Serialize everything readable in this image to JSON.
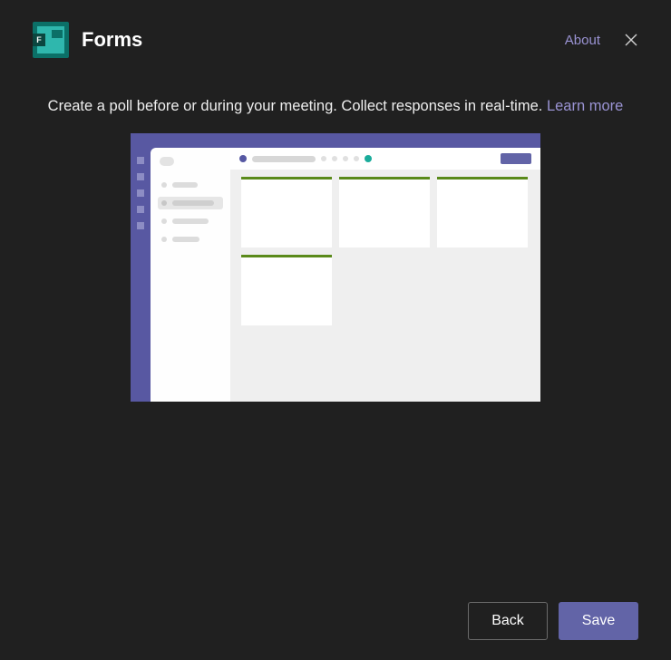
{
  "header": {
    "title": "Forms",
    "icon_letter": "F",
    "about_label": "About"
  },
  "description": {
    "text": "Create a poll before or during your meeting. Collect responses in real-time.",
    "learn_more_label": "Learn more"
  },
  "footer": {
    "back_label": "Back",
    "save_label": "Save"
  }
}
